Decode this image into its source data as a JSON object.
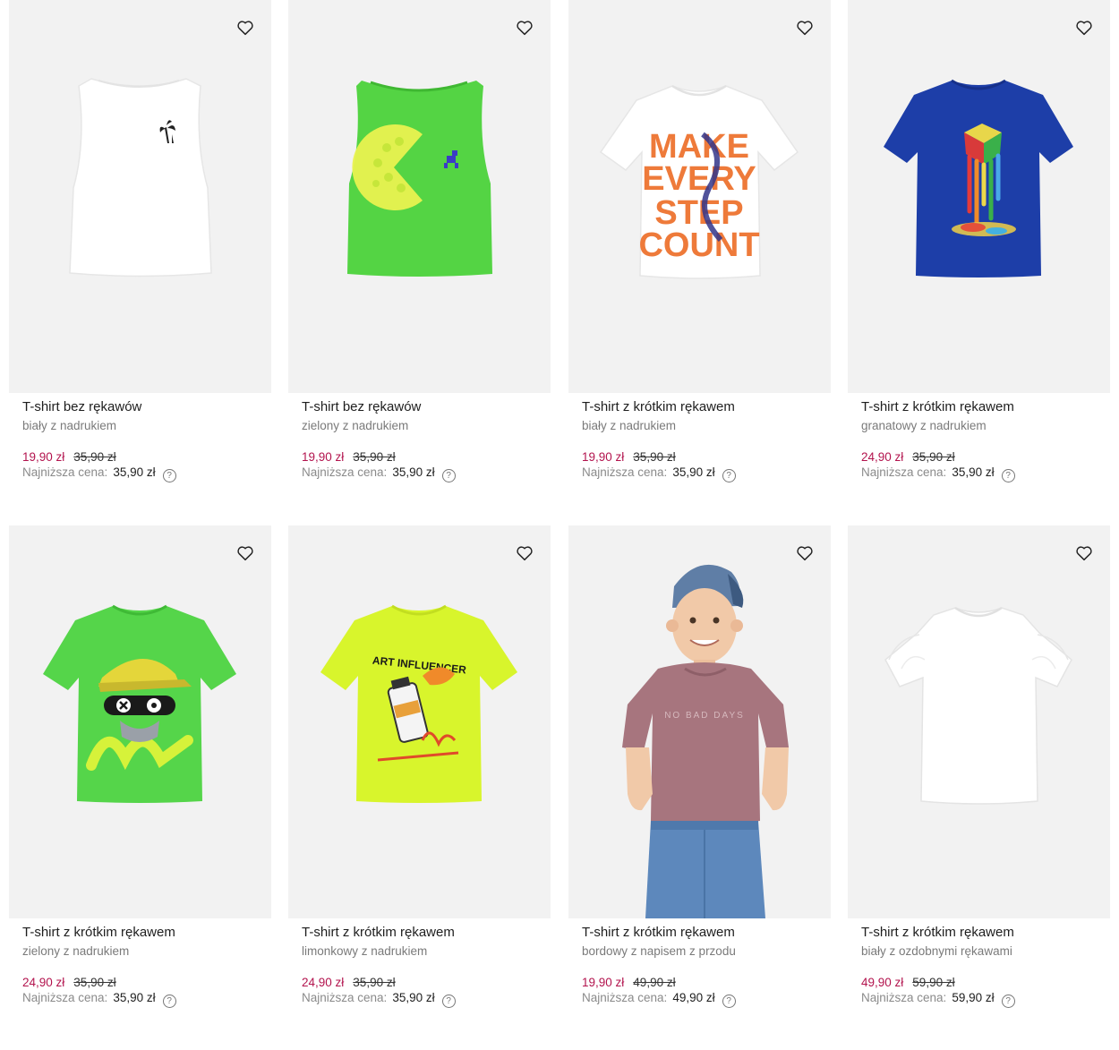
{
  "products": [
    {
      "title": "T-shirt bez rękawów",
      "subtitle": "biały z nadrukiem",
      "price": "19,90 zł",
      "old_price": "35,90 zł",
      "lowest_label": "Najniższa cena:",
      "lowest_price": "35,90 zł",
      "image": "white-sleeveless-tank-palm-print",
      "shirt_color": "#ffffff"
    },
    {
      "title": "T-shirt bez rękawów",
      "subtitle": "zielony z nadrukiem",
      "price": "19,90 zł",
      "old_price": "35,90 zł",
      "lowest_label": "Najniższa cena:",
      "lowest_price": "35,90 zł",
      "image": "green-sleeveless-tank-pacman-print",
      "shirt_color": "#54d444"
    },
    {
      "title": "T-shirt z krótkim rękawem",
      "subtitle": "biały z nadrukiem",
      "price": "19,90 zł",
      "old_price": "35,90 zł",
      "lowest_label": "Najniższa cena:",
      "lowest_price": "35,90 zł",
      "image": "white-tee-make-every-step-count",
      "shirt_color": "#ffffff",
      "print_text": [
        "MAKE",
        "EVERY",
        "STEP",
        "COUNT"
      ]
    },
    {
      "title": "T-shirt z krótkim rękawem",
      "subtitle": "granatowy z nadrukiem",
      "price": "24,90 zł",
      "old_price": "35,90 zł",
      "lowest_label": "Najniższa cena:",
      "lowest_price": "35,90 zł",
      "image": "navy-tee-melting-cube",
      "shirt_color": "#1d3ea8"
    },
    {
      "title": "T-shirt z krótkim rękawem",
      "subtitle": "zielony z nadrukiem",
      "price": "24,90 zł",
      "old_price": "35,90 zł",
      "lowest_label": "Najniższa cena:",
      "lowest_price": "35,90 zł",
      "image": "green-tee-cap-character",
      "shirt_color": "#55d54a"
    },
    {
      "title": "T-shirt z krótkim rękawem",
      "subtitle": "limonkowy z nadrukiem",
      "price": "24,90 zł",
      "old_price": "35,90 zł",
      "lowest_label": "Najniższa cena:",
      "lowest_price": "35,90 zł",
      "image": "lime-tee-spray-can",
      "shirt_color": "#d8f52c",
      "print_text": [
        "ART INFLUENCER"
      ]
    },
    {
      "title": "T-shirt z krótkim rękawem",
      "subtitle": "bordowy z napisem z przodu",
      "price": "19,90 zł",
      "old_price": "49,90 zł",
      "lowest_label": "Najniższa cena:",
      "lowest_price": "49,90 zł",
      "image": "boy-model-mauve-tee",
      "shirt_color": "#a7757e",
      "print_text": [
        "NO BAD DAYS"
      ]
    },
    {
      "title": "T-shirt z krótkim rękawem",
      "subtitle": "biały z ozdobnymi rękawami",
      "price": "49,90 zł",
      "old_price": "59,90 zł",
      "lowest_label": "Najniższa cena:",
      "lowest_price": "59,90 zł",
      "image": "white-tee-puff-sleeves",
      "shirt_color": "#ffffff"
    }
  ],
  "icons": {
    "favorite": "heart-outline-icon",
    "help": "question-circle-icon"
  },
  "help_glyph": "?",
  "colors": {
    "price_accent": "#b3144e",
    "card_bg": "#f2f2f2"
  }
}
